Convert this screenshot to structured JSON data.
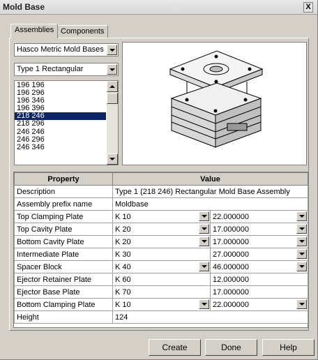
{
  "window": {
    "title": "Mold Base",
    "close_label": "X"
  },
  "tabs": [
    {
      "label": "Assemblies",
      "active": true
    },
    {
      "label": "Components",
      "active": false
    }
  ],
  "catalog_select": {
    "value": "Hasco Metric Mold Bases"
  },
  "type_select": {
    "value": "Type 1 Rectangular"
  },
  "size_list": {
    "items": [
      "196 196",
      "196 296",
      "196 346",
      "196 396",
      "218 246",
      "218 296",
      "246 246",
      "246 296",
      "246 346"
    ],
    "selected": "218 246"
  },
  "preview": {
    "icon": "mold-base-isometric-drawing"
  },
  "table": {
    "headers": {
      "property": "Property",
      "value": "Value"
    },
    "rows": [
      {
        "property": "Description",
        "value": "Type 1 (218 246) Rectangular Mold Base Assembly"
      },
      {
        "property": "Assembly prefix name",
        "value": "Moldbase"
      },
      {
        "property": "Top Clamping Plate",
        "code": "K 10",
        "thickness": "22.000000",
        "code_dropdown": true,
        "thickness_dropdown": true
      },
      {
        "property": "Top Cavity Plate",
        "code": "K 20",
        "thickness": "17.000000",
        "code_dropdown": true,
        "thickness_dropdown": true
      },
      {
        "property": "Bottom Cavity Plate",
        "code": "K 20",
        "thickness": "17.000000",
        "code_dropdown": true,
        "thickness_dropdown": true
      },
      {
        "property": "Intermediate Plate",
        "code": "K 30",
        "thickness": "27.000000",
        "code_dropdown": false,
        "thickness_dropdown": true
      },
      {
        "property": "Spacer Block",
        "code": "K 40",
        "thickness": "46.000000",
        "code_dropdown": true,
        "thickness_dropdown": true
      },
      {
        "property": "Ejector Retainer Plate",
        "code": "K 60",
        "thickness": "12.000000",
        "code_dropdown": false,
        "thickness_dropdown": false
      },
      {
        "property": "Ejector Base Plate",
        "code": "K 70",
        "thickness": "17.000000",
        "code_dropdown": false,
        "thickness_dropdown": false
      },
      {
        "property": "Bottom Clamping Plate",
        "code": "K 10",
        "thickness": "22.000000",
        "code_dropdown": true,
        "thickness_dropdown": true
      },
      {
        "property": "Height",
        "value": "124"
      }
    ]
  },
  "buttons": {
    "create": "Create",
    "done": "Done",
    "help": "Help"
  },
  "colors": {
    "selection": "#0a246a",
    "face": "#d4d0c8"
  }
}
